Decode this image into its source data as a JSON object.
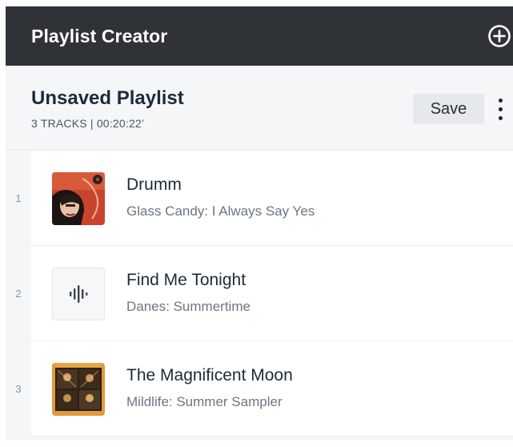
{
  "header": {
    "title": "Playlist Creator",
    "add_icon": "plus-circle-icon"
  },
  "playlist": {
    "name": "Unsaved Playlist",
    "meta": "3 TRACKS | 00:20:22’",
    "save_label": "Save",
    "more_icon": "vertical-ellipsis-icon"
  },
  "tracks": [
    {
      "number": "1",
      "title": "Drumm",
      "subtitle": "Glass Candy: I Always Say Yes",
      "artwork": "album-cover-glass-candy"
    },
    {
      "number": "2",
      "title": "Find Me Tonight",
      "subtitle": "Danes: Summertime",
      "artwork": "audio-waveform-icon"
    },
    {
      "number": "3",
      "title": "The Magnificent Moon",
      "subtitle": "Mildlife: Summer Sampler",
      "artwork": "album-cover-mildlife"
    }
  ],
  "colors": {
    "header_bg": "#2f3338",
    "page_bg": "#f4f6f8",
    "title_text": "#1d2b3a",
    "subtitle_text": "#6b7683"
  }
}
